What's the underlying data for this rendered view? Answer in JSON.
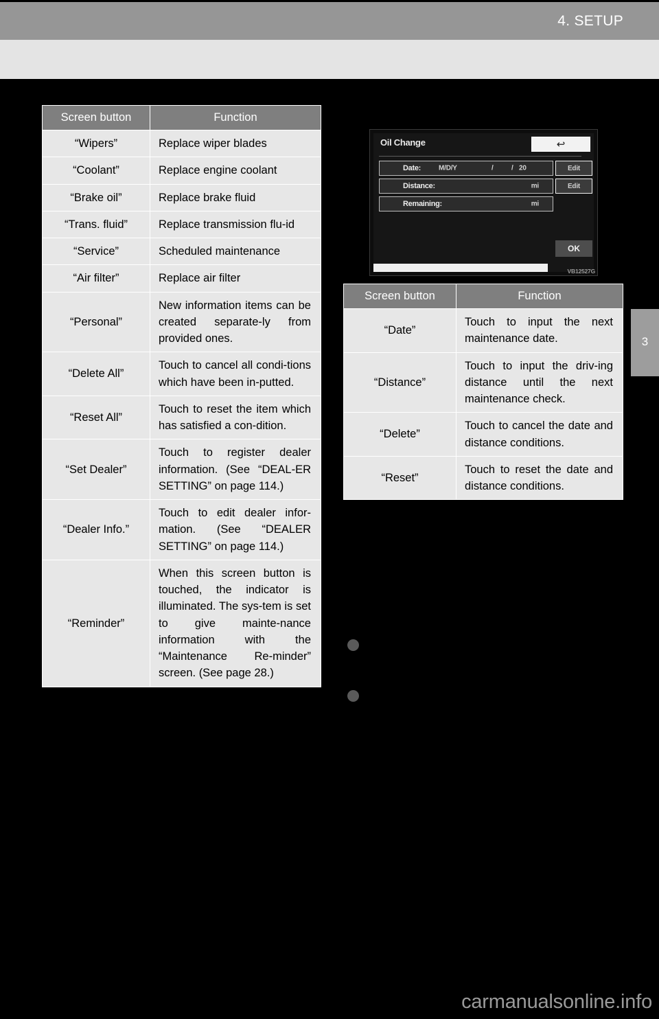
{
  "page": {
    "header_title": "4. SETUP",
    "chapter_tab_number": "3",
    "watermark": "carmanualsonline.info"
  },
  "left_table": {
    "name": "maintenance-screen-buttons",
    "headers": [
      "Screen button",
      "Function"
    ],
    "rows": [
      {
        "button": "“Wipers”",
        "function": "Replace wiper blades"
      },
      {
        "button": "“Coolant”",
        "function": "Replace engine coolant"
      },
      {
        "button": "“Brake oil”",
        "function": "Replace brake fluid"
      },
      {
        "button": "“Trans. fluid”",
        "function": "Replace transmission flu-id"
      },
      {
        "button": "“Service”",
        "function": "Scheduled maintenance"
      },
      {
        "button": "“Air filter”",
        "function": "Replace air filter"
      },
      {
        "button": "“Personal”",
        "function": "New information items can be created separate-ly from provided ones."
      },
      {
        "button": "“Delete All”",
        "function": "Touch to cancel all condi-tions which have been in-putted."
      },
      {
        "button": "“Reset All”",
        "function": "Touch to reset the item which has satisfied a con-dition."
      },
      {
        "button": "“Set Dealer”",
        "function": "Touch to register dealer information. (See “DEAL-ER SETTING” on page 114.)"
      },
      {
        "button": "“Dealer Info.”",
        "function": "Touch to edit dealer infor-mation. (See “DEALER SETTING” on page 114.)"
      },
      {
        "button": "“Reminder”",
        "function": "When this screen button is touched, the indicator is illuminated. The sys-tem is set to give mainte-nance information with the “Maintenance Re-minder” screen. (See page 28.)"
      }
    ]
  },
  "right_table": {
    "name": "oil-change-screen-buttons",
    "headers": [
      "Screen button",
      "Function"
    ],
    "rows": [
      {
        "button": "“Date”",
        "function": "Touch to input the next maintenance date."
      },
      {
        "button": "“Distance”",
        "function": "Touch to input the driv-ing distance until the next maintenance check."
      },
      {
        "button": "“Delete”",
        "function": "Touch to cancel the date and distance conditions."
      },
      {
        "button": "“Reset”",
        "function": "Touch to reset the date and distance conditions."
      }
    ]
  },
  "device_screenshot": {
    "title": "Oil Change",
    "back_icon": "↩",
    "rows": [
      {
        "label": "Date:",
        "format": "M/D/Y",
        "slash1": "/",
        "slash2": "/",
        "year_prefix": "20",
        "edit_label": "Edit"
      },
      {
        "label": "Distance:",
        "unit": "mi",
        "edit_label": "Edit"
      },
      {
        "label": "Remaining:",
        "unit": "mi"
      }
    ],
    "ok_label": "OK",
    "figure_code": "VB12527G"
  }
}
